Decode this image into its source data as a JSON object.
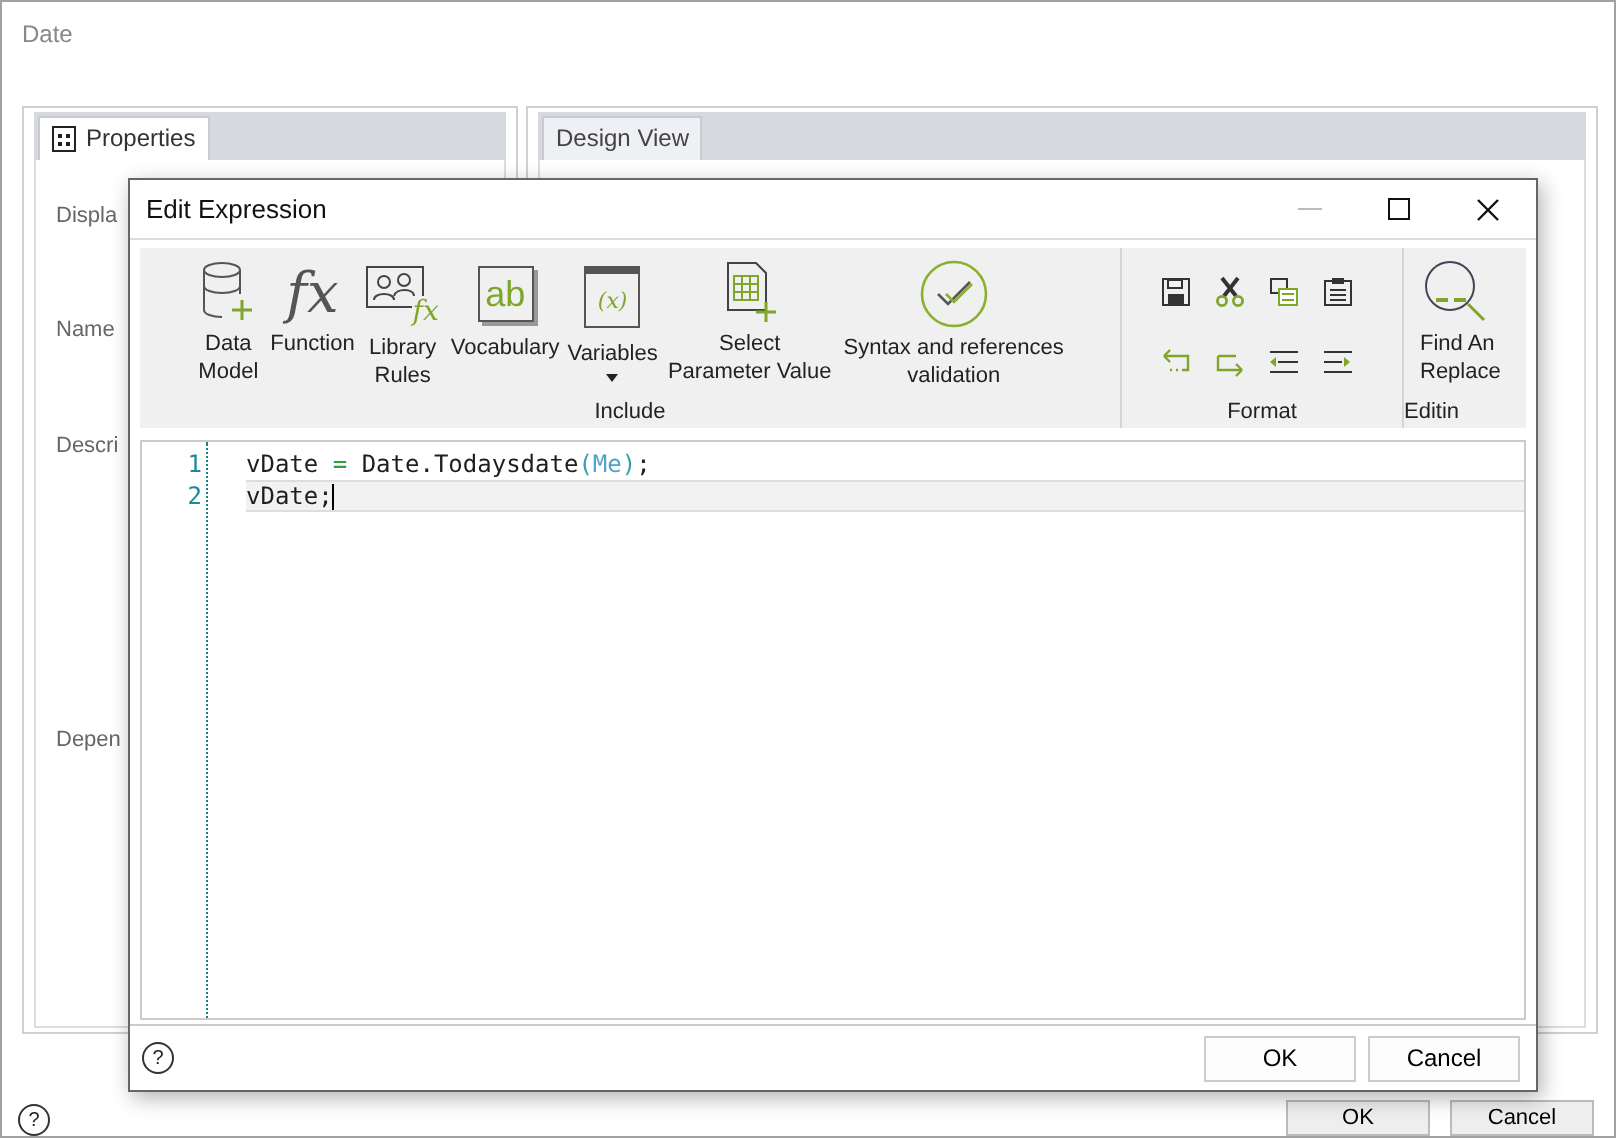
{
  "window": {
    "title": "Date",
    "help": "?"
  },
  "panels": [
    {
      "tab": "Properties",
      "selected": true,
      "fields": [
        "Displa",
        "Name",
        "Descri",
        "Depen"
      ]
    },
    {
      "tab": "Design View",
      "selected": false
    }
  ],
  "buttons": [
    "OK",
    "Cancel"
  ],
  "dialog": {
    "title": "Edit Expression",
    "groups": [
      {
        "label": "Include",
        "items": [
          {
            "kind": "database",
            "label": "Data Model"
          },
          {
            "kind": "function",
            "label": "Function",
            "glyph": "fx"
          },
          {
            "kind": "library",
            "label": "Library Rules",
            "glyph": "fx"
          },
          {
            "kind": "vocabulary",
            "label": "Vocabulary",
            "glyph": "ab"
          },
          {
            "kind": "variables",
            "label": "Variables",
            "glyph": "(x)",
            "dropdown": true
          },
          {
            "kind": "parameter",
            "label": "Select Parameter Value"
          },
          {
            "kind": "validate",
            "label": "Syntax and references validation"
          }
        ]
      },
      {
        "label": "Format",
        "items": [
          {
            "kind": "save"
          },
          {
            "kind": "cut"
          },
          {
            "kind": "copy"
          },
          {
            "kind": "paste"
          },
          {
            "kind": "undo"
          },
          {
            "kind": "redo"
          },
          {
            "kind": "outdent"
          },
          {
            "kind": "indent"
          }
        ]
      },
      {
        "label": "Editin",
        "items": [
          {
            "kind": "find",
            "label": "Find An Replace"
          }
        ]
      }
    ],
    "lines": [
      {
        "number": "1",
        "current": false,
        "tokens": [
          {
            "kind": "plain",
            "text": "vDate "
          },
          {
            "kind": "operator",
            "text": "="
          },
          {
            "kind": "plain",
            "text": " Date.Todaysdate"
          },
          {
            "kind": "paren",
            "text": "("
          },
          {
            "kind": "keyword",
            "text": "Me"
          },
          {
            "kind": "paren",
            "text": ")"
          },
          {
            "kind": "plain",
            "text": ";"
          }
        ]
      },
      {
        "number": "2",
        "current": true,
        "tokens": [
          {
            "kind": "plain",
            "text": "vDate;"
          }
        ]
      }
    ],
    "help": "?",
    "buttons": [
      "OK",
      "Cancel"
    ]
  }
}
